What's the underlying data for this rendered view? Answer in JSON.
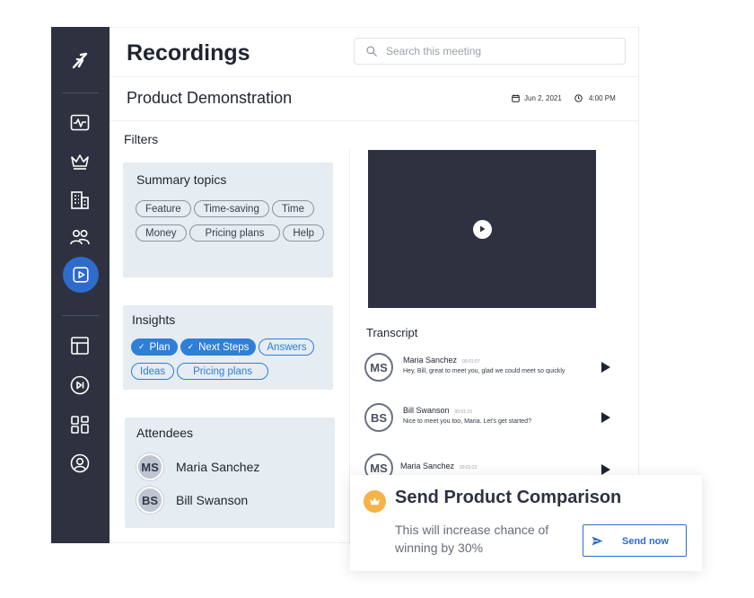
{
  "header": {
    "title": "Recordings",
    "search_placeholder": "Search this meeting",
    "meeting_title": "Product Demonstration",
    "date": "Jun 2, 2021",
    "time": "4:00 PM"
  },
  "sidebar": {
    "items": [
      {
        "icon": "logo-icon"
      },
      {
        "icon": "activity-icon"
      },
      {
        "icon": "crown-icon"
      },
      {
        "icon": "building-icon"
      },
      {
        "icon": "users-icon"
      },
      {
        "icon": "recordings-play-icon",
        "active": true
      },
      {
        "icon": "layout-icon"
      },
      {
        "icon": "next-track-icon"
      },
      {
        "icon": "apps-grid-icon"
      },
      {
        "icon": "profile-icon"
      }
    ],
    "active_color": "#2f6bcb",
    "background": "#2e3240"
  },
  "filters": {
    "label": "Filters",
    "summary_topics": {
      "title": "Summary topics",
      "tags": [
        "Feature",
        "Time-saving",
        "Time",
        "Money",
        "Pricing plans",
        "Help"
      ]
    },
    "insights": {
      "title": "Insights",
      "tags": [
        {
          "label": "Plan",
          "selected": true
        },
        {
          "label": "Next Steps",
          "selected": true
        },
        {
          "label": "Answers",
          "selected": false
        },
        {
          "label": "Ideas",
          "selected": false
        },
        {
          "label": "Pricing plans",
          "selected": false
        }
      ]
    },
    "attendees": {
      "title": "Attendees",
      "people": [
        {
          "initials": "MS",
          "name": "Maria Sanchez"
        },
        {
          "initials": "BS",
          "name": "Bill Swanson"
        }
      ]
    }
  },
  "transcript": {
    "label": "Transcript",
    "items": [
      {
        "initials": "MS",
        "name": "Maria Sanchez",
        "timestamp": "00:01:07",
        "text": "Hey, Bill, great to meet you, glad we could meet so quickly"
      },
      {
        "initials": "BS",
        "name": "Bill Swanson",
        "timestamp": "00:01:15",
        "text": "Nice to meet you too, Maria. Let's get started?"
      },
      {
        "initials": "MS",
        "name": "Maria Sanchez",
        "timestamp": "00:01:22",
        "text": ""
      }
    ]
  },
  "action_card": {
    "icon": "crown-icon",
    "title": "Send Product Comparison",
    "description": "This will increase chance of winning by 30%",
    "button_label": "Send now",
    "accent": "#f5b347"
  }
}
